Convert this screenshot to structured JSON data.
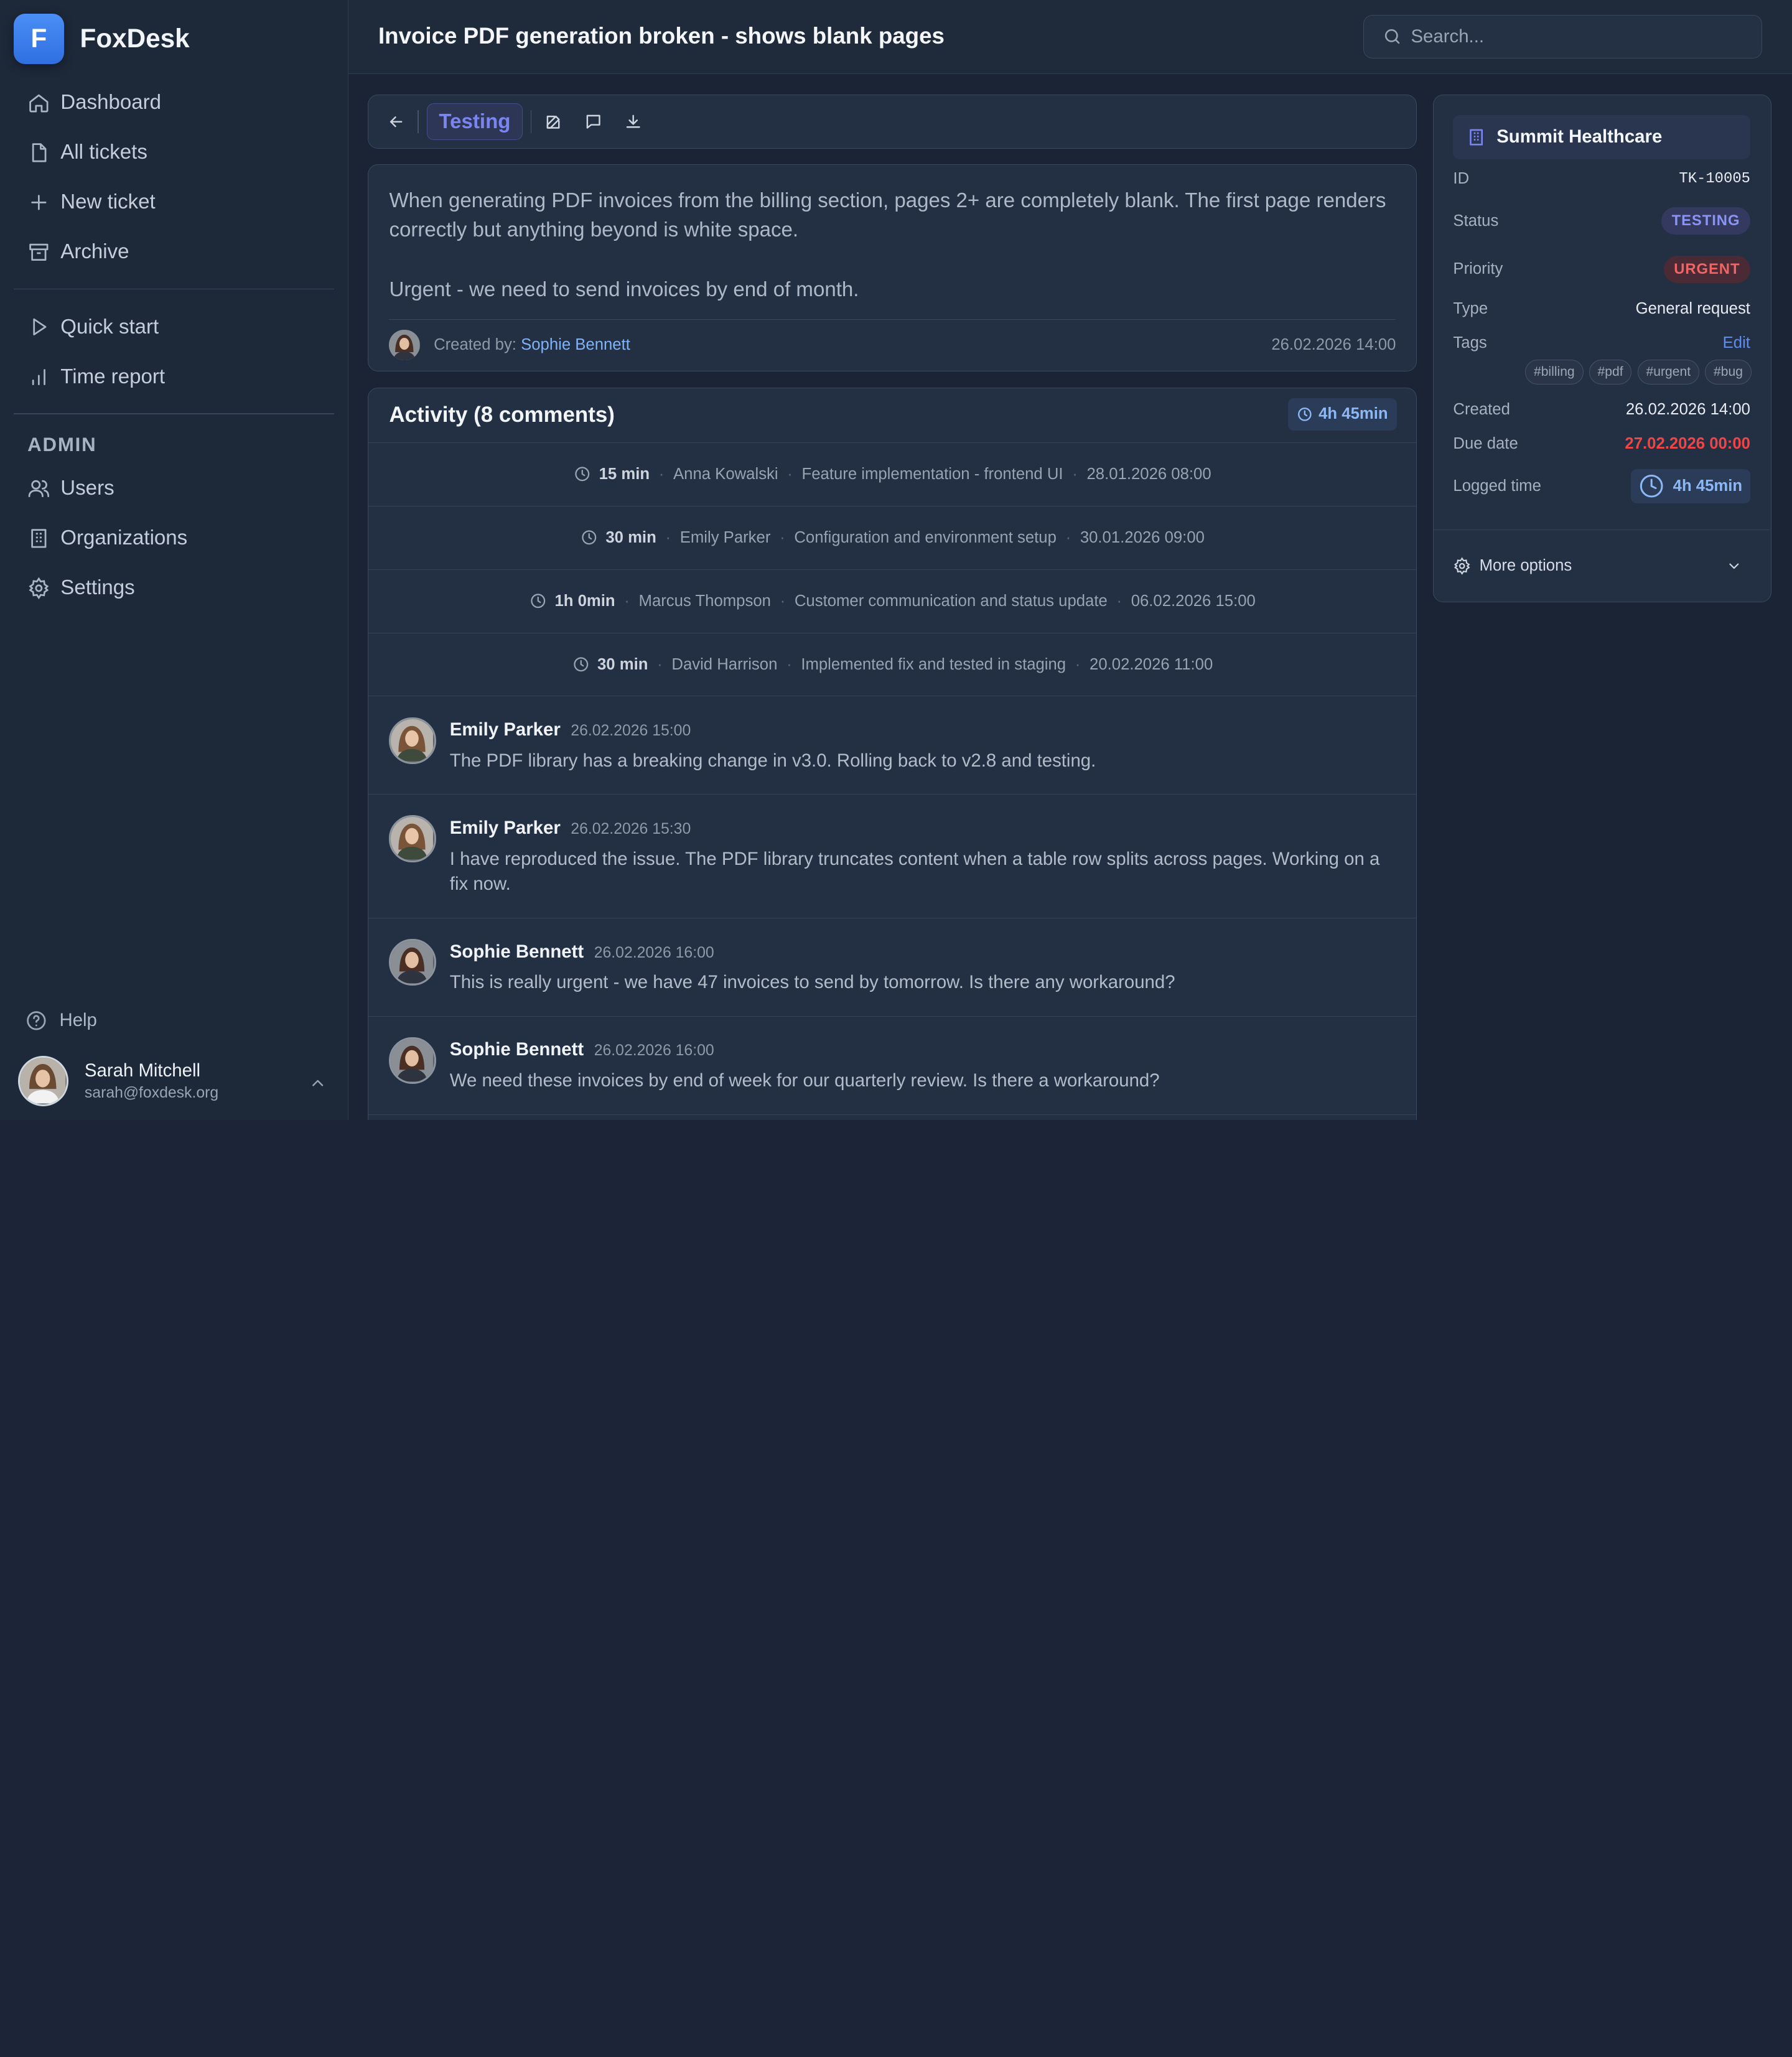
{
  "app": {
    "name": "FoxDesk",
    "logo_letter": "F"
  },
  "nav": {
    "items": [
      {
        "label": "Dashboard",
        "icon": "home-icon"
      },
      {
        "label": "All tickets",
        "icon": "file-icon"
      },
      {
        "label": "New ticket",
        "icon": "plus-icon"
      },
      {
        "label": "Archive",
        "icon": "archive-icon"
      }
    ],
    "secondary": [
      {
        "label": "Quick start",
        "icon": "play-icon"
      },
      {
        "label": "Time report",
        "icon": "bar-chart-icon"
      }
    ],
    "admin_heading": "ADMIN",
    "admin": [
      {
        "label": "Users",
        "icon": "users-icon"
      },
      {
        "label": "Organizations",
        "icon": "building-icon"
      },
      {
        "label": "Settings",
        "icon": "gear-icon"
      }
    ],
    "help": "Help"
  },
  "user": {
    "name": "Sarah Mitchell",
    "email": "sarah@foxdesk.org"
  },
  "header": {
    "title": "Invoice PDF generation broken - shows blank pages",
    "search_placeholder": "Search..."
  },
  "toolbar": {
    "status_label": "Testing"
  },
  "ticket": {
    "description": "When generating PDF invoices from the billing section, pages 2+ are completely blank. The first page renders correctly but anything beyond is white space.\n\nUrgent - we need to send invoices by end of month.",
    "created_by_label": "Created by:",
    "created_by": "Sophie Bennett",
    "created_at": "26.02.2026 14:00"
  },
  "activity": {
    "title": "Activity (8 comments)",
    "total_time": "4h 45min",
    "time_logs": [
      {
        "duration": "15 min",
        "author": "Anna Kowalski",
        "note": "Feature implementation - frontend UI",
        "date": "28.01.2026 08:00"
      },
      {
        "duration": "30 min",
        "author": "Emily Parker",
        "note": "Configuration and environment setup",
        "date": "30.01.2026 09:00"
      },
      {
        "duration": "1h 0min",
        "author": "Marcus Thompson",
        "note": "Customer communication and status update",
        "date": "06.02.2026 15:00"
      },
      {
        "duration": "30 min",
        "author": "David Harrison",
        "note": "Implemented fix and tested in staging",
        "date": "20.02.2026 11:00"
      }
    ],
    "comments": [
      {
        "author": "Emily Parker",
        "date": "26.02.2026 15:00",
        "text": "The PDF library has a breaking change in v3.0. Rolling back to v2.8 and testing."
      },
      {
        "author": "Emily Parker",
        "date": "26.02.2026 15:30",
        "text": "I have reproduced the issue. The PDF library truncates content when a table row splits across pages. Working on a fix now."
      },
      {
        "author": "Sophie Bennett",
        "date": "26.02.2026 16:00",
        "text": "This is really urgent - we have 47 invoices to send by tomorrow. Is there any workaround?"
      },
      {
        "author": "Sophie Bennett",
        "date": "26.02.2026 16:00",
        "text": "We need these invoices by end of week for our quarterly review. Is there a workaround?"
      }
    ]
  },
  "details": {
    "organization": "Summit Healthcare",
    "id_label": "ID",
    "id": "TK-10005",
    "status_label": "Status",
    "status": "TESTING",
    "priority_label": "Priority",
    "priority": "URGENT",
    "type_label": "Type",
    "type": "General request",
    "tags_label": "Tags",
    "tags_edit": "Edit",
    "tags": [
      "#billing",
      "#pdf",
      "#urgent",
      "#bug"
    ],
    "created_label": "Created",
    "created": "26.02.2026 14:00",
    "due_label": "Due date",
    "due": "27.02.2026 00:00",
    "logged_label": "Logged time",
    "logged": "4h 45min",
    "more_options": "More options"
  },
  "colors": {
    "accent": "#3b82f6",
    "status_testing": "#7b85f2",
    "urgent": "#f04545",
    "background": "#1a2435"
  }
}
